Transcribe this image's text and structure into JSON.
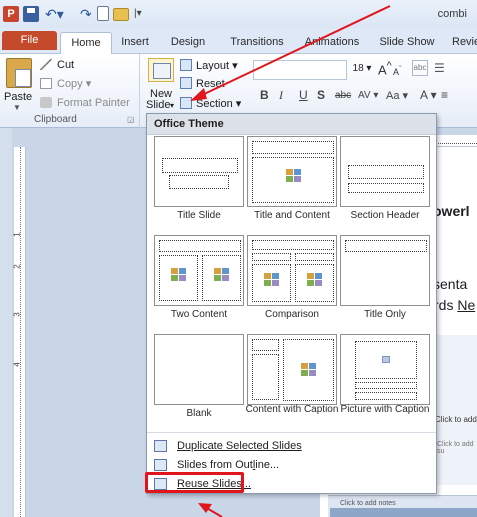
{
  "app": {
    "logo_letter": "P",
    "window_title": "combi"
  },
  "tabs": [
    "File",
    "Home",
    "Insert",
    "Design",
    "Transitions",
    "Animations",
    "Slide Show",
    "Revie"
  ],
  "ribbon": {
    "clipboard": {
      "paste": "Paste",
      "cut": "Cut",
      "copy": "Copy",
      "format_painter": "Format Painter",
      "group_label": "Clipboard"
    },
    "slides": {
      "new_slide_line1": "New",
      "new_slide_line2": "Slide",
      "layout": "Layout",
      "reset": "Reset",
      "section": "Section"
    },
    "font": {
      "size": "18",
      "bold": "B",
      "italic": "I",
      "underline": "U",
      "strike": "S",
      "shadow": "abc",
      "spacing": "AV",
      "change_case": "Aa",
      "color": "A",
      "grow": "A",
      "shrink": "A"
    }
  },
  "dropdown": {
    "header": "Office Theme",
    "layouts": [
      {
        "label": "Title Slide"
      },
      {
        "label": "Title and Content"
      },
      {
        "label": "Section Header"
      },
      {
        "label": "Two Content"
      },
      {
        "label": "Comparison"
      },
      {
        "label": "Title Only"
      },
      {
        "label": "Blank"
      },
      {
        "label": "Content with Caption"
      },
      {
        "label": "Picture with Caption"
      }
    ],
    "menu": {
      "duplicate": "Duplicate Selected Slides",
      "outline_pre": "Slides from Out",
      "outline_u": "l",
      "outline_post": "ine...",
      "reuse": "Reuse Slides..."
    }
  },
  "slide": {
    "text_a": "owerl",
    "text_b": "senta",
    "text_c_pre": "rds ",
    "text_c_u": "Ne",
    "thumb_caption": "Click to add",
    "thumb_sub": "Click to add su",
    "bottom_caption": "Click to add notes"
  },
  "ruler_numbers": [
    "1",
    "2",
    "3",
    "4"
  ],
  "colors": {
    "file_tab": "#c54a2b",
    "annotation_red": "#e1151b"
  }
}
